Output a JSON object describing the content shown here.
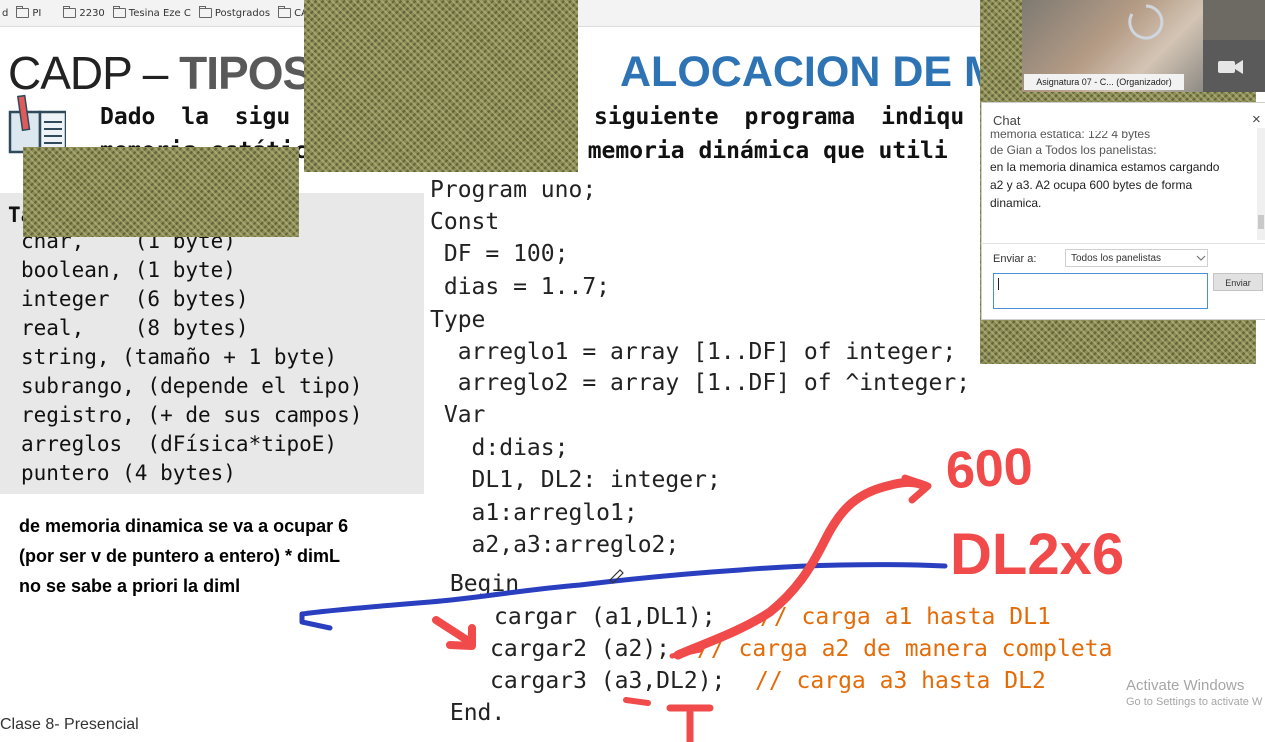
{
  "bookmarks": [
    {
      "label": "d"
    },
    {
      "label": "PI"
    },
    {
      "label": "2230"
    },
    {
      "label": "Tesina Eze C"
    },
    {
      "label": "Postgrados"
    },
    {
      "label": "CADP y T"
    }
  ],
  "slide": {
    "title_left": "CADP",
    "title_dash": "–",
    "title_gray": "TIPOS",
    "title_right": "ALOCACION DE M",
    "question_line1_a": "Dado la sigu",
    "question_line1_b": "siguiente programa indiqu",
    "question_line2_a": "memoria estátic",
    "question_line2_b": "e memoria dinámica que utili",
    "types_header": "Ta",
    "types": [
      "char,    (1 byte)",
      "boolean, (1 byte)",
      "integer  (6 bytes)",
      "real,    (8 bytes)",
      "string, (tamaño + 1 byte)",
      "subrango, (depende el tipo)",
      "registro, (+ de sus campos)",
      "arreglos  (dFísica*tipoE)",
      "puntero (4 bytes)"
    ],
    "code": [
      "Program uno;",
      "Const",
      " DF = 100;",
      " dias = 1..7;",
      "Type",
      "  arreglo1 = array [1..DF] of integer;",
      "  arreglo2 = array [1..DF] of ^integer;",
      " Var",
      "   d:dias;",
      "   DL1, DL2: integer;",
      "   a1:arreglo1;",
      "   a2,a3:arreglo2;",
      " Begin",
      "cargar (a1,DL1);",
      "cargar2 (a2);",
      "cargar3 (a3,DL2);",
      " End."
    ],
    "comments": [
      "// carga a1 hasta DL1",
      "// carga a2 de manera completa",
      "// carga a3 hasta DL2"
    ],
    "footer": "Clase 8- Presencial"
  },
  "notes": [
    "de memoria dinamica se va a ocupar 6",
    "(por ser v de puntero a entero) * dimL",
    "no se sabe a priori la diml"
  ],
  "handwriting": {
    "top": "600",
    "bottom": "DL2x6"
  },
  "watermark": {
    "line1": "Activate Windows",
    "line2": "Go to Settings to activate W"
  },
  "video": {
    "label": "Asignatura 07 - C... (Organizador)"
  },
  "chat": {
    "title": "Chat",
    "close": "×",
    "lines": [
      "memoria estatica: 122 4 bytes",
      "de Gian a Todos los panelistas:",
      "en la memoria dinamica estamos cargando",
      "a2 y a3. A2 ocupa 600 bytes de forma",
      "dinamica."
    ],
    "send_to_label": "Enviar a:",
    "send_to_value": "Todos los panelistas",
    "send_button": "Enviar"
  },
  "colors": {
    "title_blue": "#2e74b5",
    "comment_orange": "#e36c09",
    "ink_red": "#f04a4a",
    "ink_blue": "#2a3fc0"
  }
}
